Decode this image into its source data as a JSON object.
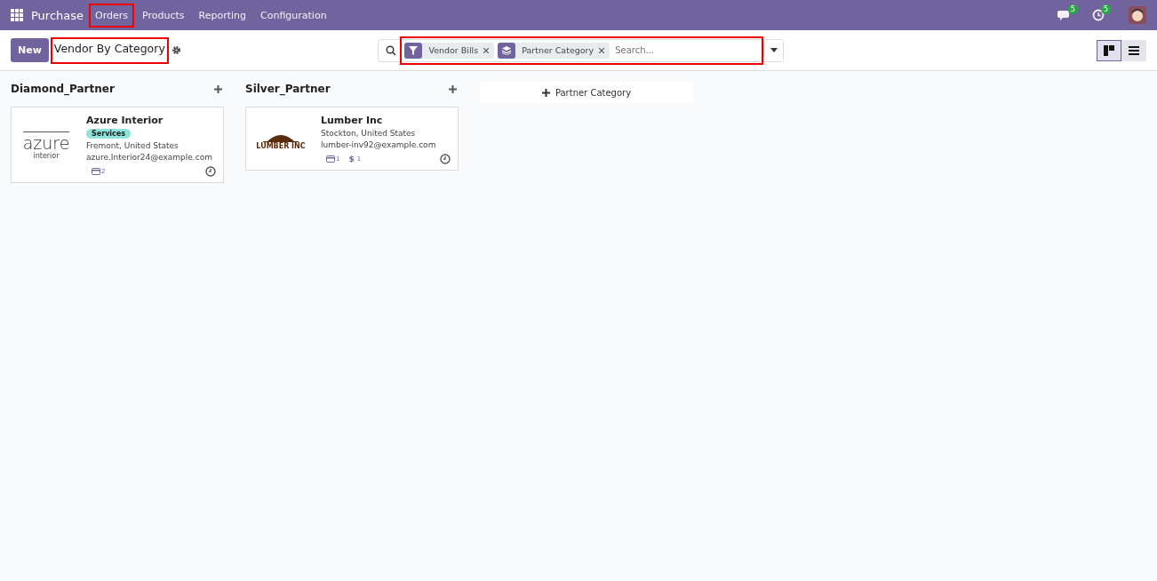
{
  "navbar": {
    "app_name": "Purchase",
    "menu": [
      {
        "label": "Orders",
        "highlighted": true
      },
      {
        "label": "Products",
        "highlighted": false
      },
      {
        "label": "Reporting",
        "highlighted": false
      },
      {
        "label": "Configuration",
        "highlighted": false
      }
    ],
    "messages_badge": "5",
    "activities_badge": "5"
  },
  "control_panel": {
    "new_button": "New",
    "title": "Vendor By Category",
    "title_highlighted": true,
    "search": {
      "highlighted": true,
      "facets": [
        {
          "kind": "filter",
          "label": "Vendor Bills"
        },
        {
          "kind": "group",
          "label": "Partner Category"
        }
      ],
      "placeholder": "Search..."
    },
    "views": [
      {
        "kind": "kanban",
        "selected": true
      },
      {
        "kind": "list",
        "selected": false
      }
    ]
  },
  "columns": [
    {
      "title": "Diamond_Partner",
      "cards": [
        {
          "name": "Azure Interior",
          "logo": {
            "kind": "azure",
            "line1": "azure",
            "line2": "interior"
          },
          "tags": [
            {
              "label": "Services",
              "color": "#8ee3da"
            }
          ],
          "location": "Fremont, United States",
          "email": "azure.Interior24@example.com",
          "counters": [
            {
              "kind": "bills",
              "count": "2"
            }
          ]
        }
      ]
    },
    {
      "title": "Silver_Partner",
      "cards": [
        {
          "name": "Lumber Inc",
          "logo": {
            "kind": "lumber",
            "line1": "LUMBER INC"
          },
          "location": "Stockton, United States",
          "email": "lumber-inv92@example.com",
          "counters": [
            {
              "kind": "bills",
              "count": "1"
            },
            {
              "kind": "payments",
              "symbol": "$",
              "count": "1"
            }
          ]
        }
      ]
    }
  ],
  "add_column": "Partner Category"
}
